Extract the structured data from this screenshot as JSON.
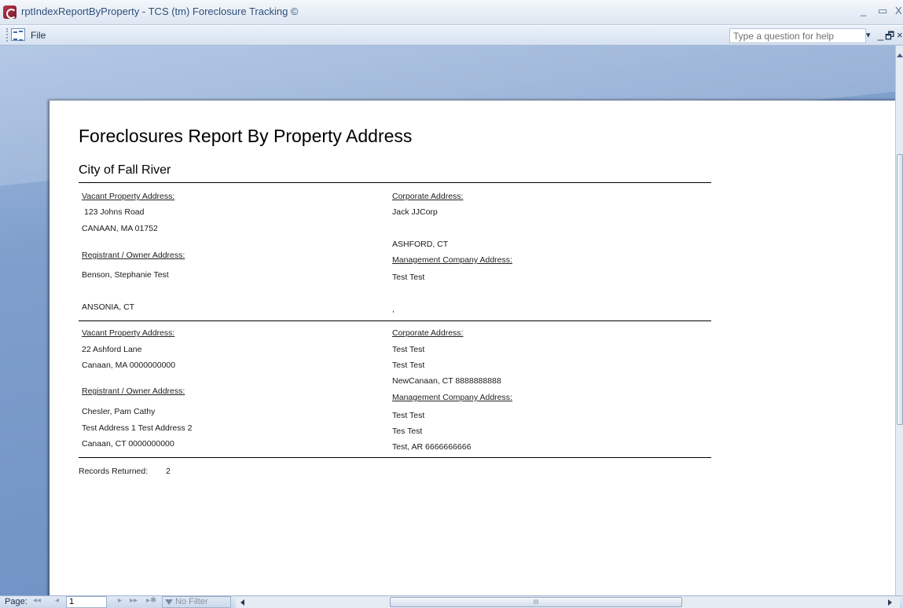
{
  "window": {
    "title": "rptIndexReportByProperty - TCS (tm) Foreclosure Tracking ©",
    "minimize": "_",
    "restore": "▭",
    "close": "X"
  },
  "menu": {
    "file_label": "File",
    "help_placeholder": "Type a question for help",
    "help_dropdown": "▾",
    "mdi_minimize": "_",
    "mdi_restore": "🗗",
    "mdi_close": "×"
  },
  "report": {
    "title": "Foreclosures Report By Property Address",
    "subtitle": "City of Fall River",
    "records": [
      {
        "vacant_label": "Vacant Property Address:",
        "vacant_line1": "123 Johns Road",
        "vacant_line2": "CANAAN, MA 01752",
        "registrant_label": "Registrant / Owner Address:",
        "registrant_name": "Benson, Stephanie Test",
        "registrant_line1": "",
        "registrant_line2": "ANSONIA, CT",
        "corporate_label": "Corporate Address:",
        "corporate_line1": "Jack JJCorp",
        "corporate_line2": "",
        "corporate_line3": "ASHFORD, CT",
        "management_label": "Management Company Address:",
        "management_line1": "Test Test",
        "management_line2": "",
        "management_line3": ","
      },
      {
        "vacant_label": "Vacant Property Address:",
        "vacant_line1": "22 Ashford Lane",
        "vacant_line2": "Canaan, MA 0000000000",
        "registrant_label": "Registrant / Owner Address:",
        "registrant_name": "Chesler, Pam Cathy",
        "registrant_line1": "Test Address 1 Test Address 2",
        "registrant_line2": "Canaan, CT 0000000000",
        "corporate_label": "Corporate Address:",
        "corporate_line1": "Test Test",
        "corporate_line2": "Test Test",
        "corporate_line3": "NewCanaan, CT 8888888888",
        "management_label": "Management Company Address:",
        "management_line1": "Test Test",
        "management_line2": "Tes Test",
        "management_line3": "Test, AR 6666666666"
      }
    ],
    "records_returned_label": "Records Returned:",
    "records_returned_value": "2"
  },
  "statusbar": {
    "page_label": "Page:",
    "first": "◂◂",
    "prev": "◂",
    "page_value": "1",
    "next": "▸",
    "last": "▸▸",
    "new": "▸✱",
    "filter_label": "No Filter",
    "hscroll_grip": "III"
  }
}
